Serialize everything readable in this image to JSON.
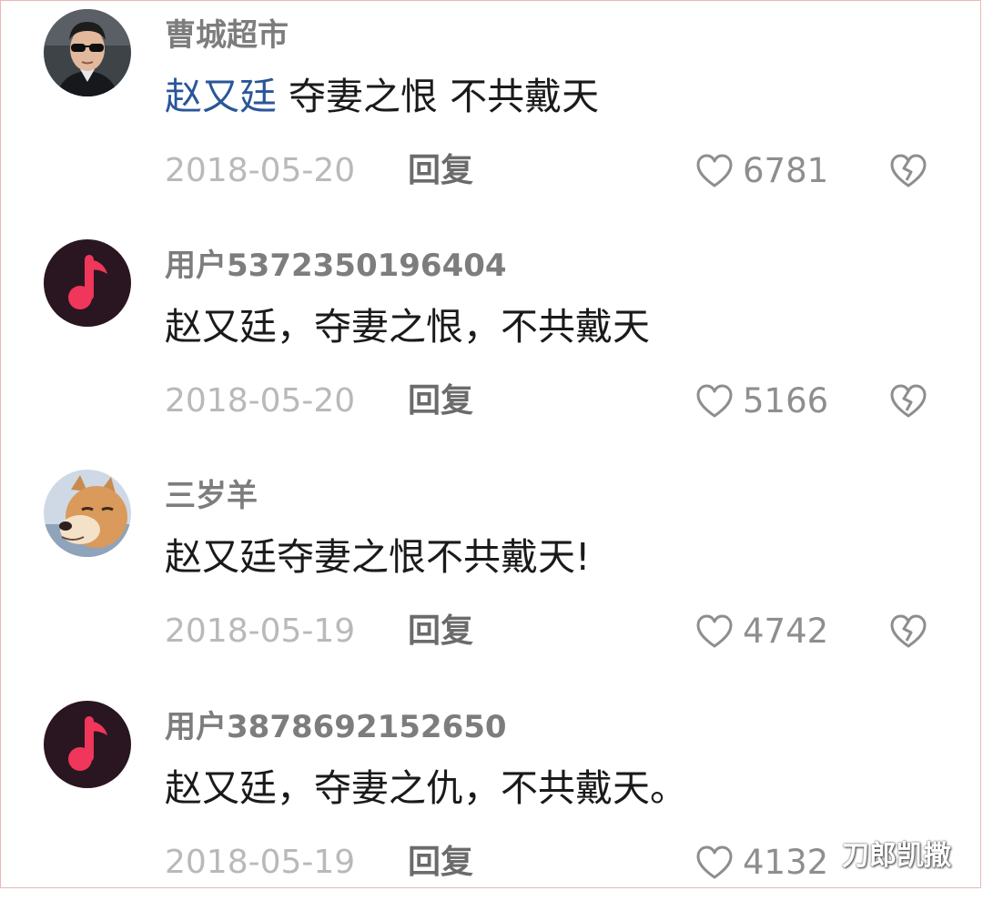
{
  "comments": [
    {
      "username": "曹城超市",
      "mention": "赵又廷",
      "text": " 夺妻之恨 不共戴天",
      "date": "2018-05-20",
      "reply_label": "回复",
      "likes": "6781",
      "avatar": "man-with-sunglasses-photo"
    },
    {
      "username": "用户5372350196404",
      "mention": "",
      "text": "赵又廷，夺妻之恨，不共戴天",
      "date": "2018-05-20",
      "reply_label": "回复",
      "likes": "5166",
      "avatar": "music-note-icon"
    },
    {
      "username": "三岁羊",
      "mention": "",
      "text": "赵又廷夺妻之恨不共戴天!",
      "date": "2018-05-19",
      "reply_label": "回复",
      "likes": "4742",
      "avatar": "shiba-dog-photo"
    },
    {
      "username": "用户3878692152650",
      "mention": "",
      "text": "赵又廷，夺妻之仇，不共戴天。",
      "date": "2018-05-19",
      "reply_label": "回复",
      "likes": "4132",
      "avatar": "music-note-icon"
    }
  ],
  "watermark": "刀郎凯撒",
  "colors": {
    "mention": "#2a5699",
    "username": "#7d7d7d",
    "date": "#b9b9b9",
    "music_avatar_bg": "#2a1620",
    "music_note": "#f0365a"
  }
}
